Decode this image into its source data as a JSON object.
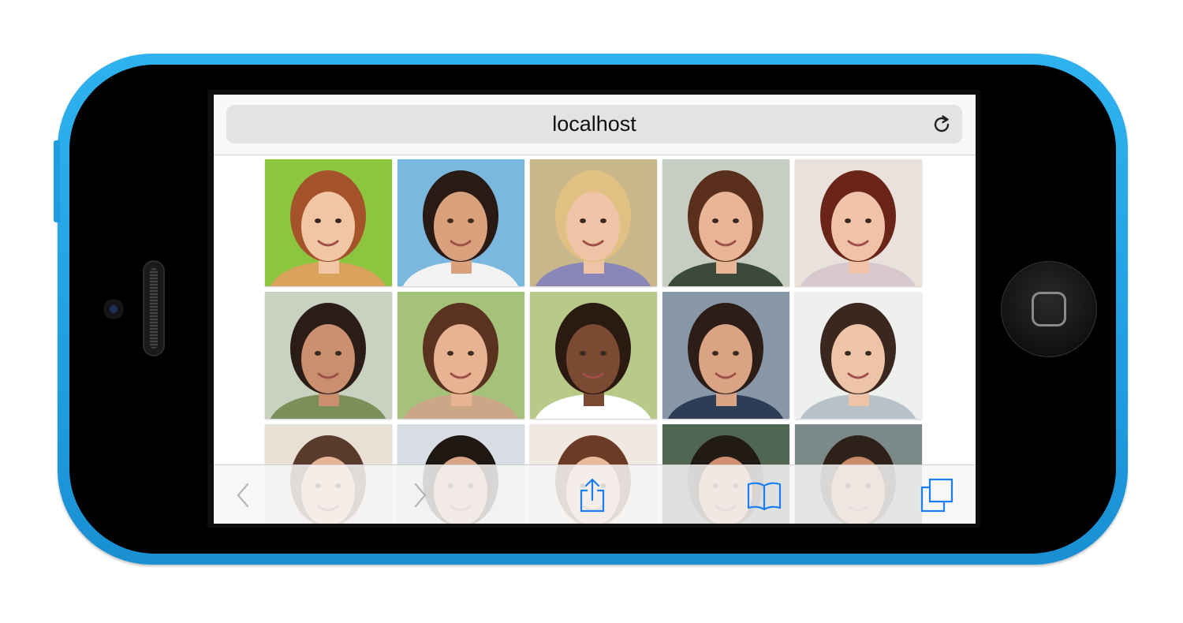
{
  "browser": {
    "url_label": "localhost"
  },
  "gallery": {
    "rows": [
      [
        {
          "name": "portrait-1",
          "bg": "#8cc63f",
          "skin": "#f0c6a4",
          "hair": "#a5532a",
          "shirt": "#d9a35b"
        },
        {
          "name": "portrait-2",
          "bg": "#7ab8df",
          "skin": "#d9a27c",
          "hair": "#2a1a14",
          "shirt": "#f2f2f2"
        },
        {
          "name": "portrait-3",
          "bg": "#c8b78a",
          "skin": "#efc4a6",
          "hair": "#e0c083",
          "shirt": "#8a87b8"
        },
        {
          "name": "portrait-4",
          "bg": "#c8cdc4",
          "skin": "#e8b596",
          "hair": "#5a2f1c",
          "shirt": "#3b4a3a"
        },
        {
          "name": "portrait-5",
          "bg": "#e9e2dc",
          "skin": "#f0c2a8",
          "hair": "#6b2418",
          "shirt": "#d8c7cf"
        }
      ],
      [
        {
          "name": "portrait-6",
          "bg": "#c9d1c0",
          "skin": "#c98f6e",
          "hair": "#2a1c16",
          "shirt": "#7a8f5a"
        },
        {
          "name": "portrait-7",
          "bg": "#a5c27a",
          "skin": "#e8b392",
          "hair": "#5a3320",
          "shirt": "#caa787"
        },
        {
          "name": "portrait-8",
          "bg": "#b9c98a",
          "skin": "#7a4a32",
          "hair": "#2a1a12",
          "shirt": "#ffffff"
        },
        {
          "name": "portrait-9",
          "bg": "#8797a8",
          "skin": "#d9a384",
          "hair": "#2c1e17",
          "shirt": "#2d3d55"
        },
        {
          "name": "portrait-10",
          "bg": "#eef0ee",
          "skin": "#eec4a8",
          "hair": "#3a2820",
          "shirt": "#b8c0c8"
        }
      ],
      [
        {
          "name": "portrait-11",
          "bg": "#e8dfd5",
          "skin": "#e6b597",
          "hair": "#5a3a2c",
          "shirt": "#cccccc"
        },
        {
          "name": "portrait-12",
          "bg": "#d7dde2",
          "skin": "#d9a585",
          "hair": "#1f1712",
          "shirt": "#cccccc"
        },
        {
          "name": "portrait-13",
          "bg": "#efe9e2",
          "skin": "#eab99a",
          "hair": "#6d3a26",
          "shirt": "#cccccc"
        },
        {
          "name": "portrait-14",
          "bg": "#4e6652",
          "skin": "#d09070",
          "hair": "#221a14",
          "shirt": "#cccccc"
        },
        {
          "name": "portrait-15",
          "bg": "#7b8a88",
          "skin": "#c98a66",
          "hair": "#2d2119",
          "shirt": "#cccccc"
        }
      ]
    ]
  },
  "toolbar": {
    "back_icon": "chevron-left-icon",
    "forward_icon": "chevron-right-icon",
    "share_icon": "share-icon",
    "bookmarks_icon": "book-icon",
    "tabs_icon": "tabs-icon",
    "accent": "#1a7ef2",
    "disabled": "#b5b5b5"
  },
  "device": {
    "body_color": "#27a8ea"
  }
}
